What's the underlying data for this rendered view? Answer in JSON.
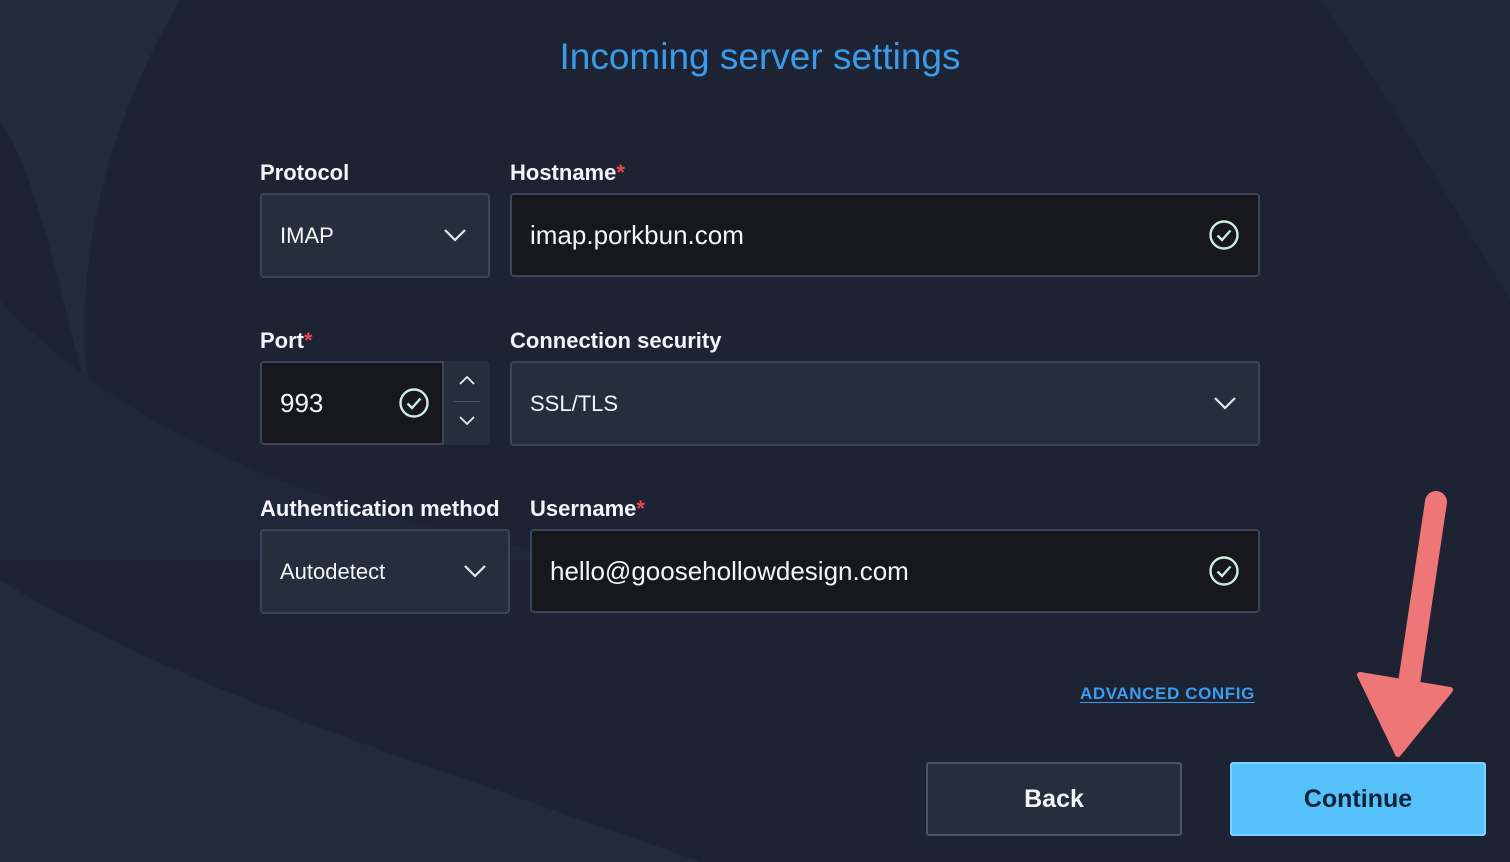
{
  "page": {
    "title": "Incoming server settings"
  },
  "form": {
    "protocol": {
      "label": "Protocol",
      "value": "IMAP"
    },
    "hostname": {
      "label": "Hostname",
      "required_marker": "*",
      "value": "imap.porkbun.com"
    },
    "port": {
      "label": "Port",
      "required_marker": "*",
      "value": "993"
    },
    "connection_security": {
      "label": "Connection security",
      "value": "SSL/TLS"
    },
    "auth_method": {
      "label": "Authentication method",
      "value": "Autodetect"
    },
    "username": {
      "label": "Username",
      "required_marker": "*",
      "value": "hello@goosehollowdesign.com"
    }
  },
  "links": {
    "advanced_config": "ADVANCED CONFIG"
  },
  "buttons": {
    "back": "Back",
    "continue": "Continue"
  },
  "icons": {
    "valid": "check-circle-icon",
    "dropdown": "chevron-down-icon",
    "step_up": "chevron-up-icon",
    "step_down": "chevron-down-icon",
    "annotation": "arrow-down-icon"
  },
  "colors": {
    "background": "#1d2333",
    "title": "#3a9be8",
    "required": "#e84a4a",
    "link": "#3b9df0",
    "primary_button": "#55c2fb",
    "annotation_arrow": "#ef7676"
  }
}
